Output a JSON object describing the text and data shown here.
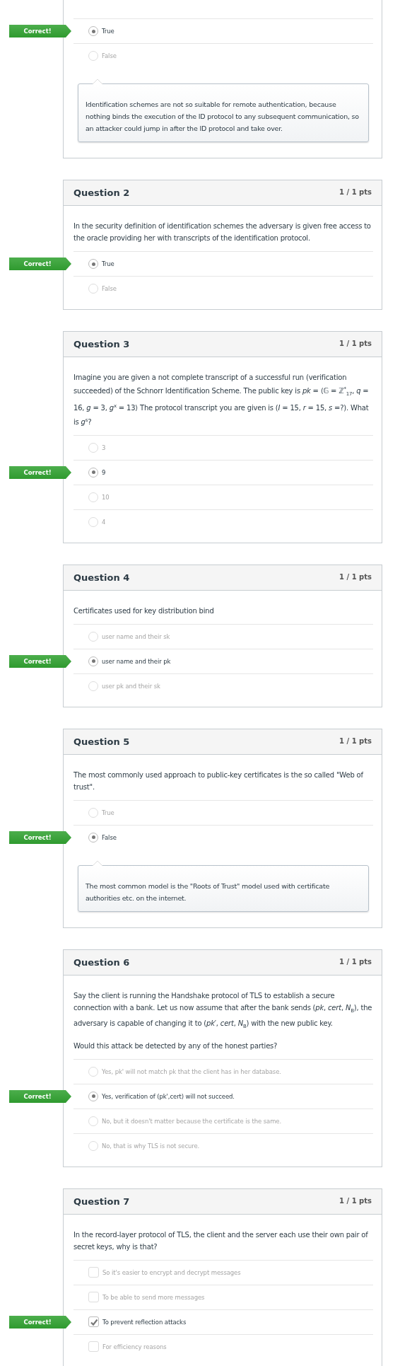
{
  "questions": [
    {
      "answers": [
        {
          "kind": "radio",
          "text": "True",
          "selected": true,
          "badge": "Correct!"
        },
        {
          "kind": "radio",
          "text": "False",
          "selected": false
        }
      ],
      "feedback": "Identification schemes are not so suitable for remote authentication, because nothing binds the execution of the ID protocol to any subsequent communication, so an attacker could jump in after the ID protocol and take over."
    },
    {
      "title": "Question 2",
      "points": "1 / 1 pts",
      "prompt": [
        "In the security definition of identification schemes the adversary is given free access to the oracle providing her with transcripts of the identification protocol."
      ],
      "answers": [
        {
          "kind": "radio",
          "text": "True",
          "selected": true,
          "badge": "Correct!"
        },
        {
          "kind": "radio",
          "text": "False",
          "selected": false
        }
      ]
    },
    {
      "title": "Question 3",
      "points": "1 / 1 pts",
      "prompt": [
        "Imagine you are given a not complete transcript of a successful run (verification succeeded) of the Schnorr Identification Scheme. The public key is *pk* = ⟨𝔾 = ℤ$^{*}$$_{17}$, *q* = 16, *g* = 3, *g*$^{x}$ = 13⟩ The protocol transcript you are given is (*I* = 15, *r* = 15, *s* =?). What is *g*$^{s}$?"
      ],
      "answers": [
        {
          "kind": "radio",
          "text": "3",
          "selected": false
        },
        {
          "kind": "radio",
          "text": "9",
          "selected": true,
          "badge": "Correct!"
        },
        {
          "kind": "radio",
          "text": "10",
          "selected": false
        },
        {
          "kind": "radio",
          "text": "4",
          "selected": false
        }
      ]
    },
    {
      "title": "Question 4",
      "points": "1 / 1 pts",
      "prompt": [
        "Certificates used for key distribution bind"
      ],
      "answers": [
        {
          "kind": "radio",
          "text": "user name and their sk",
          "selected": false
        },
        {
          "kind": "radio",
          "text": "user name and their pk",
          "selected": true,
          "badge": "Correct!"
        },
        {
          "kind": "radio",
          "text": "user pk and their sk",
          "selected": false
        }
      ]
    },
    {
      "title": "Question 5",
      "points": "1 / 1 pts",
      "prompt": [
        "The most commonly used approach to public-key certificates is the so called \"Web of trust\"."
      ],
      "answers": [
        {
          "kind": "radio",
          "text": "True",
          "selected": false
        },
        {
          "kind": "radio",
          "text": "False",
          "selected": true,
          "badge": "Correct!"
        }
      ],
      "feedback": "The most common model is the \"Roots of Trust\" model used with certificate authorities etc. on the internet."
    },
    {
      "title": "Question 6",
      "points": "1 / 1 pts",
      "prompt": [
        "Say the client is running the Handshake protocol of TLS to establish a secure connection with a bank. Let us now assume that after the bank sends (*pk*, *cert*, *N*$_{B}$), the adversary is capable of changing it to (*pk*′, *cert*, *N*$_{B}$) with the new public key.",
        "Would this attack be detected by any of the honest parties?"
      ],
      "answers": [
        {
          "kind": "radio",
          "text": "Yes, pk' will not match pk that the client has in her database.",
          "selected": false
        },
        {
          "kind": "radio",
          "text": "Yes, verification of (pk',cert) will not succeed.",
          "selected": true,
          "badge": "Correct!"
        },
        {
          "kind": "radio",
          "text": "No, but it doesn't matter because the certificate is the same.",
          "selected": false
        },
        {
          "kind": "radio",
          "text": "No, that is why TLS is not secure.",
          "selected": false
        }
      ]
    },
    {
      "title": "Question 7",
      "points": "1 / 1 pts",
      "prompt": [
        "In the record-layer protocol of TLS, the client and the server each use their own pair of secret keys, why is that?"
      ],
      "answers": [
        {
          "kind": "checkbox",
          "text": "So it's easier to encrypt and decrypt messages",
          "selected": false
        },
        {
          "kind": "checkbox",
          "text": "To be able to send more messages",
          "selected": false
        },
        {
          "kind": "checkbox",
          "text": "To prevent reflection attacks",
          "selected": true,
          "badge": "Correct!"
        },
        {
          "kind": "checkbox",
          "text": "For efficiency reasons",
          "selected": false
        }
      ]
    }
  ]
}
